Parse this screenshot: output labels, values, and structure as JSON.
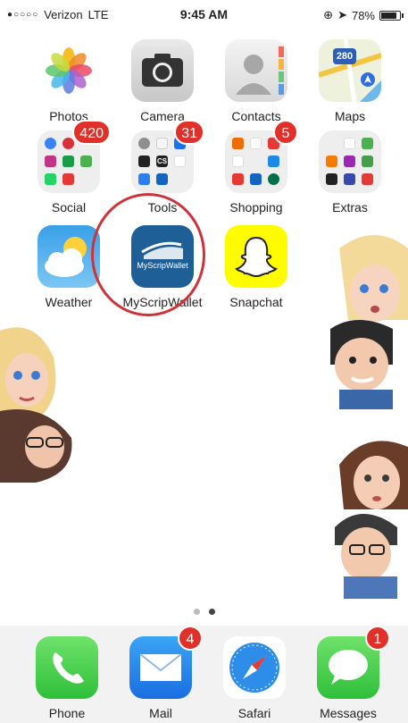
{
  "status_bar": {
    "signal_dots": "●○○○○",
    "carrier": "Verizon",
    "network": "LTE",
    "time": "9:45 AM",
    "battery_percent": "78%",
    "battery_level": 0.78
  },
  "row1": [
    {
      "label": "Photos",
      "icon": "photos-icon"
    },
    {
      "label": "Camera",
      "icon": "camera-icon"
    },
    {
      "label": "Contacts",
      "icon": "contacts-icon"
    },
    {
      "label": "Maps",
      "icon": "maps-icon",
      "map_shield": "280"
    }
  ],
  "row2": [
    {
      "label": "Social",
      "badge": "420",
      "icon": "folder-icon"
    },
    {
      "label": "Tools",
      "badge": "31",
      "icon": "folder-icon",
      "mini_letters": "CS"
    },
    {
      "label": "Shopping",
      "badge": "5",
      "icon": "folder-icon"
    },
    {
      "label": "Extras",
      "icon": "folder-icon"
    }
  ],
  "row3": [
    {
      "label": "Weather",
      "icon": "weather-icon"
    },
    {
      "label": "MyScripWallet",
      "icon": "myscripwallet-icon",
      "icon_text": "MyScripWallet"
    },
    {
      "label": "Snapchat",
      "icon": "snapchat-ghost-icon"
    }
  ],
  "page_indicator": {
    "count": 2,
    "active": 1
  },
  "dock": [
    {
      "label": "Phone",
      "icon": "phone-icon"
    },
    {
      "label": "Mail",
      "badge": "4",
      "icon": "mail-icon"
    },
    {
      "label": "Safari",
      "icon": "safari-compass-icon"
    },
    {
      "label": "Messages",
      "badge": "1",
      "icon": "messages-bubble-icon"
    }
  ],
  "colors": {
    "badge": "#e0302a",
    "highlight_circle": "#d0323a",
    "myscrip_blue": "#1e5f97",
    "snapchat_yellow": "#fffc00"
  }
}
